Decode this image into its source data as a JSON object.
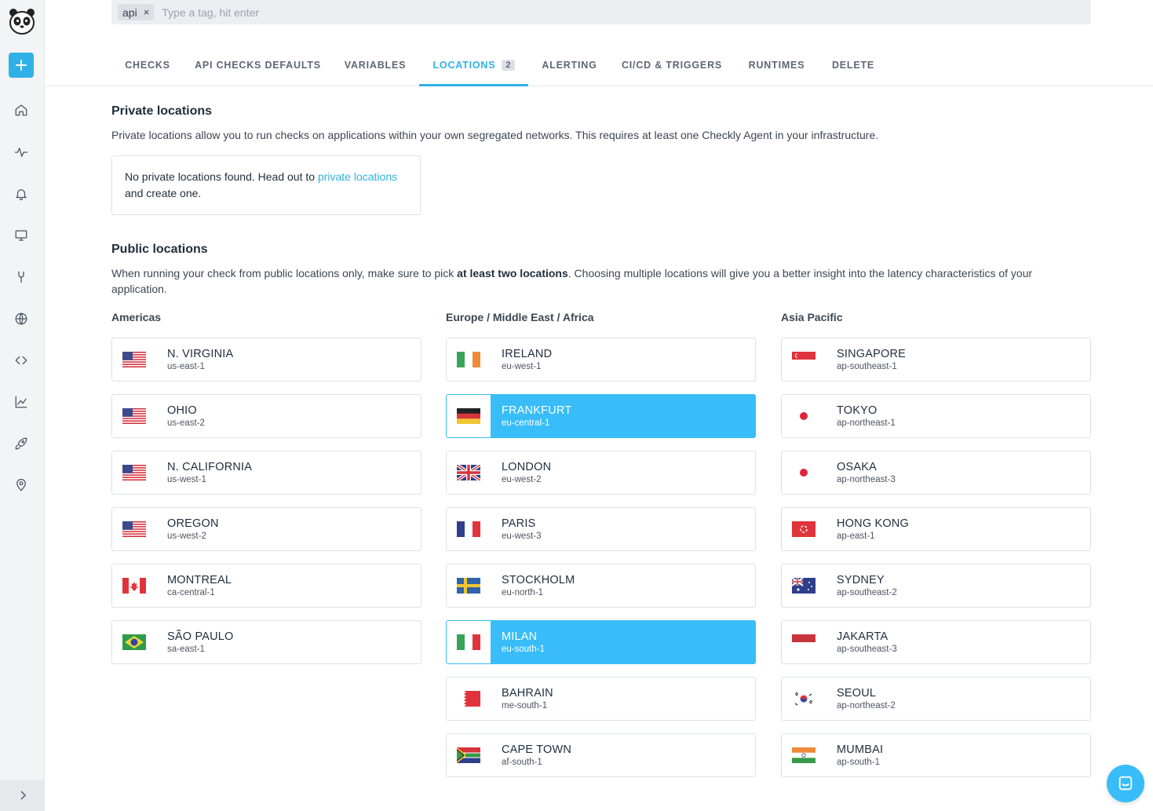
{
  "tag_input": {
    "tags": [
      "api"
    ],
    "remove_glyph": "×",
    "placeholder": "Type a tag, hit enter"
  },
  "tabs": [
    {
      "label": "CHECKS"
    },
    {
      "label": "API CHECKS DEFAULTS"
    },
    {
      "label": "VARIABLES"
    },
    {
      "label": "LOCATIONS",
      "badge": "2",
      "active": true
    },
    {
      "label": "ALERTING"
    },
    {
      "label": "CI/CD & TRIGGERS"
    },
    {
      "label": "RUNTIMES"
    },
    {
      "label": "DELETE"
    }
  ],
  "private": {
    "title": "Private locations",
    "description": "Private locations allow you to run checks on applications within your own segregated networks. This requires at least one Checkly Agent in your infrastructure.",
    "empty_prefix": "No private locations found. Head out to ",
    "empty_link": "private locations",
    "empty_suffix": " and create one."
  },
  "public": {
    "title": "Public locations",
    "desc_prefix": "When running your check from public locations only, make sure to pick ",
    "desc_bold": "at least two locations",
    "desc_suffix": ". Choosing multiple locations will give you a better insight into the latency characteristics of your application."
  },
  "regions": [
    {
      "title": "Americas",
      "locations": [
        {
          "name": "N. VIRGINIA",
          "code": "us-east-1",
          "flag": "us",
          "selected": false
        },
        {
          "name": "OHIO",
          "code": "us-east-2",
          "flag": "us",
          "selected": false
        },
        {
          "name": "N. CALIFORNIA",
          "code": "us-west-1",
          "flag": "us",
          "selected": false
        },
        {
          "name": "OREGON",
          "code": "us-west-2",
          "flag": "us",
          "selected": false
        },
        {
          "name": "MONTREAL",
          "code": "ca-central-1",
          "flag": "ca",
          "selected": false
        },
        {
          "name": "SÃO PAULO",
          "code": "sa-east-1",
          "flag": "br",
          "selected": false
        }
      ]
    },
    {
      "title": "Europe / Middle East / Africa",
      "locations": [
        {
          "name": "IRELAND",
          "code": "eu-west-1",
          "flag": "ie",
          "selected": false
        },
        {
          "name": "FRANKFURT",
          "code": "eu-central-1",
          "flag": "de",
          "selected": true
        },
        {
          "name": "LONDON",
          "code": "eu-west-2",
          "flag": "gb",
          "selected": false
        },
        {
          "name": "PARIS",
          "code": "eu-west-3",
          "flag": "fr",
          "selected": false
        },
        {
          "name": "STOCKHOLM",
          "code": "eu-north-1",
          "flag": "se",
          "selected": false
        },
        {
          "name": "MILAN",
          "code": "eu-south-1",
          "flag": "it",
          "selected": true
        },
        {
          "name": "BAHRAIN",
          "code": "me-south-1",
          "flag": "bh",
          "selected": false
        },
        {
          "name": "CAPE TOWN",
          "code": "af-south-1",
          "flag": "za",
          "selected": false
        }
      ]
    },
    {
      "title": "Asia Pacific",
      "locations": [
        {
          "name": "SINGAPORE",
          "code": "ap-southeast-1",
          "flag": "sg",
          "selected": false
        },
        {
          "name": "TOKYO",
          "code": "ap-northeast-1",
          "flag": "jp",
          "selected": false
        },
        {
          "name": "OSAKA",
          "code": "ap-northeast-3",
          "flag": "jp",
          "selected": false
        },
        {
          "name": "HONG KONG",
          "code": "ap-east-1",
          "flag": "hk",
          "selected": false
        },
        {
          "name": "SYDNEY",
          "code": "ap-southeast-2",
          "flag": "au",
          "selected": false
        },
        {
          "name": "JAKARTA",
          "code": "ap-southeast-3",
          "flag": "id",
          "selected": false
        },
        {
          "name": "SEOUL",
          "code": "ap-northeast-2",
          "flag": "kr",
          "selected": false
        },
        {
          "name": "MUMBAI",
          "code": "ap-south-1",
          "flag": "in",
          "selected": false
        }
      ]
    }
  ],
  "sidebar_icons": [
    "home-icon",
    "activity-icon",
    "bell-icon",
    "monitor-icon",
    "tools-icon",
    "globe-icon",
    "code-icon",
    "chart-icon",
    "rocket-icon",
    "map-pin-icon"
  ],
  "colors": {
    "accent": "#2fb1e8",
    "selected_fill": "#38bdf8"
  }
}
